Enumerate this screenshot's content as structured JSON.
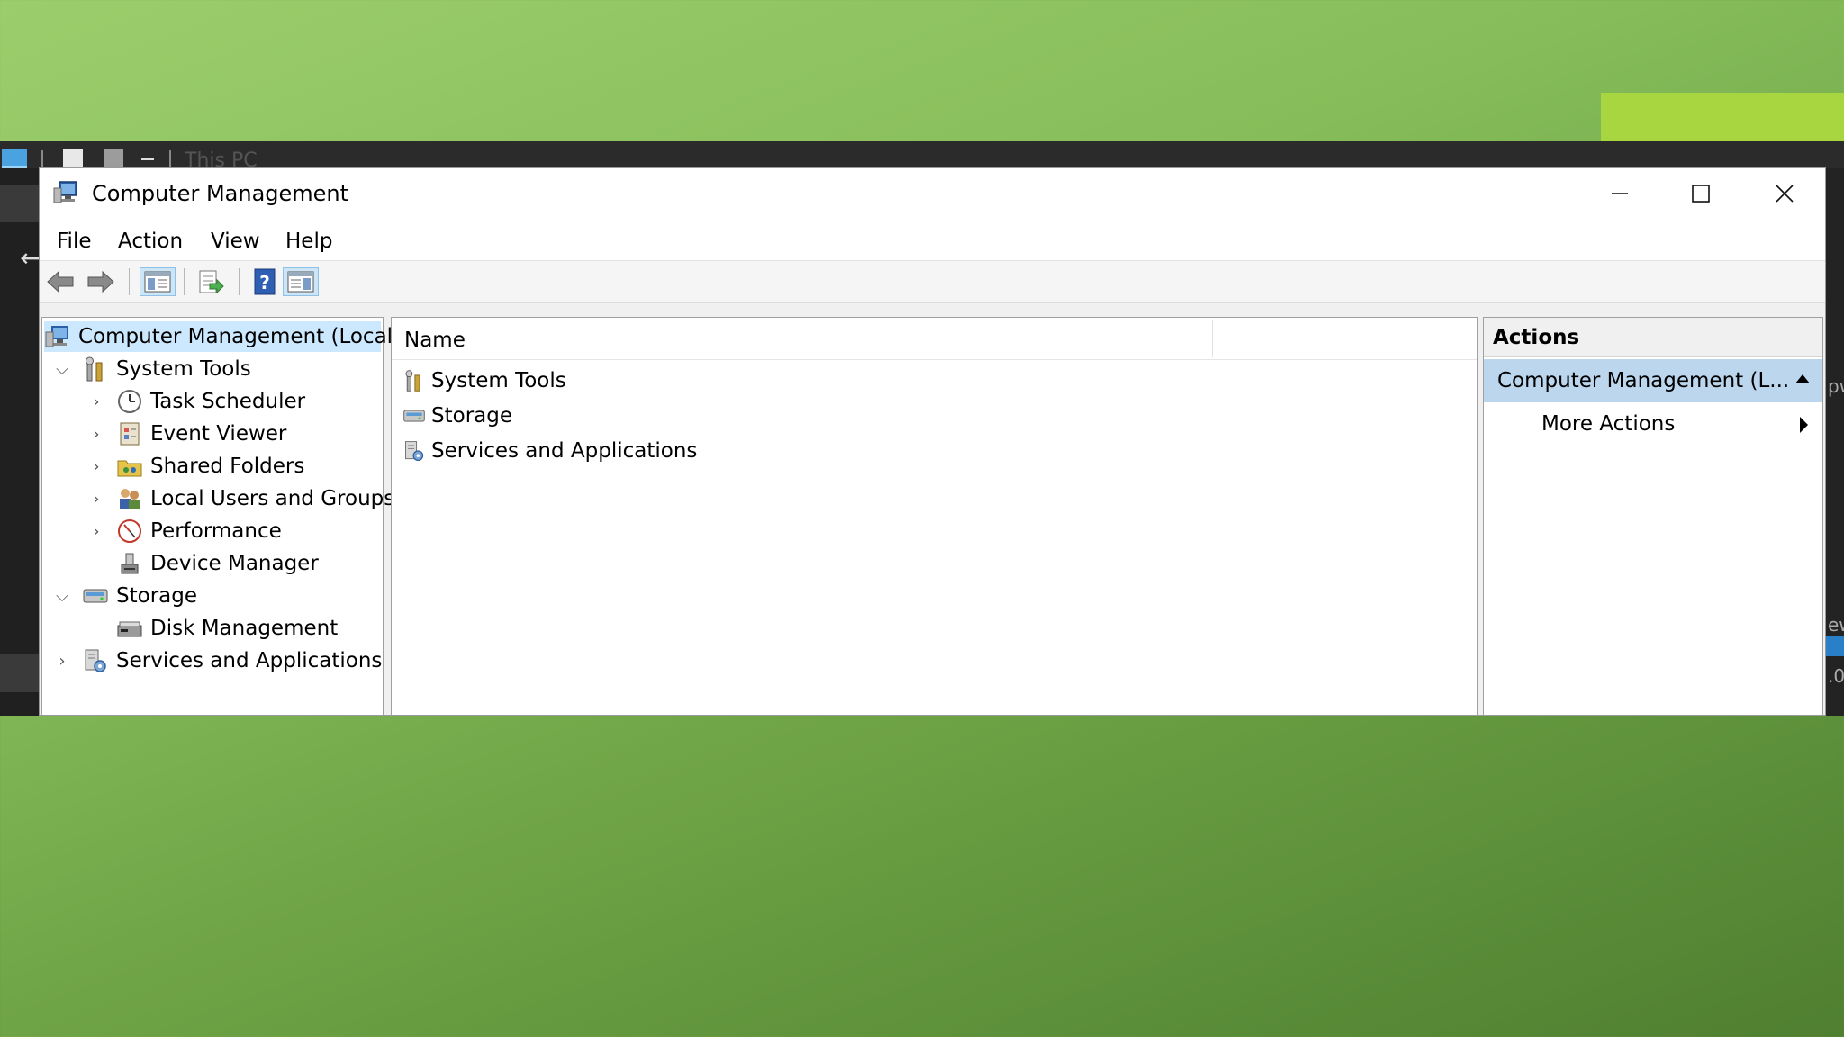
{
  "background": {
    "title_fragment": "This PC",
    "right_fragments": [
      "pw",
      "ew",
      ".0"
    ]
  },
  "window": {
    "title": "Computer Management",
    "controls": {
      "minimize": "—",
      "maximize": "☐",
      "close": "✕"
    }
  },
  "menu": [
    "File",
    "Action",
    "View",
    "Help"
  ],
  "toolbar": {
    "buttons": [
      "back-icon",
      "forward-icon",
      "show-hide-console-tree-icon",
      "export-list-icon",
      "help-icon",
      "show-hide-action-pane-icon"
    ]
  },
  "tree": {
    "root": "Computer Management (Local",
    "system_tools": "System Tools",
    "task_scheduler": "Task Scheduler",
    "event_viewer": "Event Viewer",
    "shared_folders": "Shared Folders",
    "local_users": "Local Users and Groups",
    "performance": "Performance",
    "device_manager": "Device Manager",
    "storage": "Storage",
    "disk_management": "Disk Management",
    "services": "Services and Applications"
  },
  "list": {
    "column_name": "Name",
    "items": [
      "System Tools",
      "Storage",
      "Services and Applications"
    ]
  },
  "actions": {
    "header": "Actions",
    "group": "Computer Management (L...",
    "more": "More Actions"
  },
  "colors": {
    "accent": "#a8d640",
    "selection": "#cce8ff",
    "action_group": "#bcd6ee"
  }
}
